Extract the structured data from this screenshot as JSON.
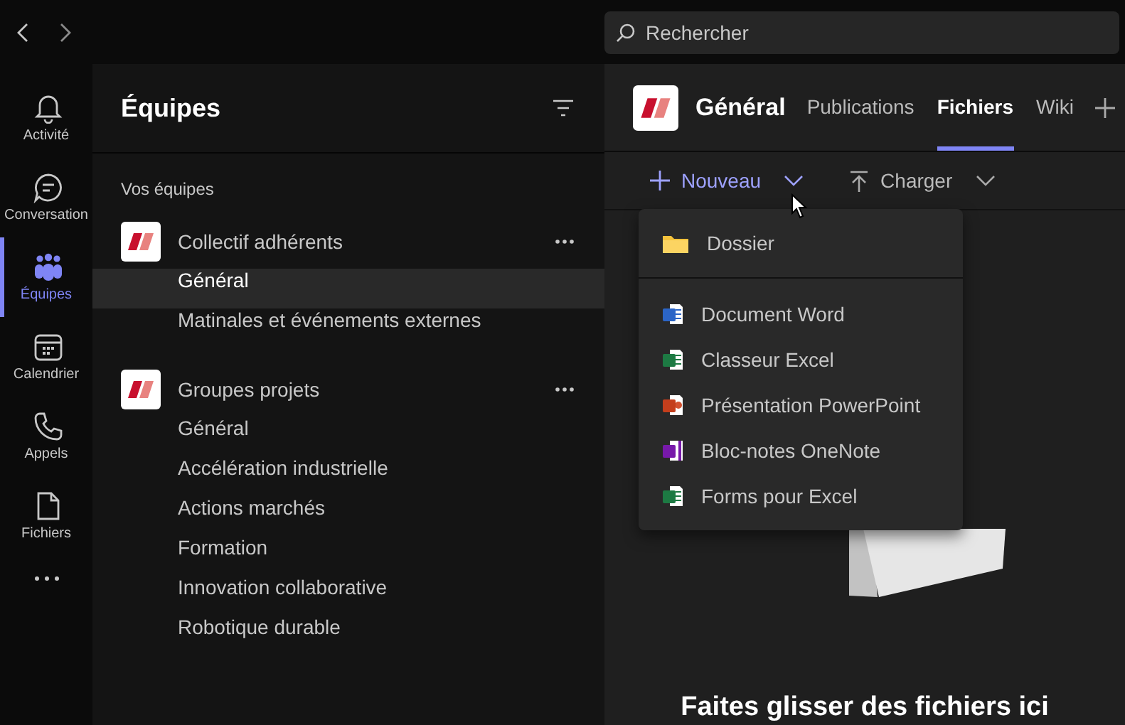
{
  "search": {
    "placeholder": "Rechercher"
  },
  "rail": [
    {
      "label": "Activité",
      "kind": "bell",
      "selected": false
    },
    {
      "label": "Conversation",
      "kind": "chat",
      "selected": false
    },
    {
      "label": "Équipes",
      "kind": "teams",
      "selected": true
    },
    {
      "label": "Calendrier",
      "kind": "calendar",
      "selected": false
    },
    {
      "label": "Appels",
      "kind": "phone",
      "selected": false
    },
    {
      "label": "Fichiers",
      "kind": "file",
      "selected": false
    }
  ],
  "teams_panel": {
    "title": "Équipes",
    "section": "Vos équipes",
    "teams": [
      {
        "name": "Collectif adhérents",
        "channels": [
          {
            "name": "Général",
            "selected": true
          },
          {
            "name": "Matinales et événements externes",
            "selected": false
          }
        ]
      },
      {
        "name": "Groupes projets",
        "channels": [
          {
            "name": "Général",
            "selected": false
          },
          {
            "name": "Accélération industrielle",
            "selected": false
          },
          {
            "name": "Actions marchés",
            "selected": false
          },
          {
            "name": "Formation",
            "selected": false
          },
          {
            "name": "Innovation collaborative",
            "selected": false
          },
          {
            "name": "Robotique durable",
            "selected": false
          }
        ]
      }
    ]
  },
  "channel": {
    "title": "Général",
    "tabs": [
      {
        "label": "Publications",
        "selected": false
      },
      {
        "label": "Fichiers",
        "selected": true
      },
      {
        "label": "Wiki",
        "selected": false
      }
    ]
  },
  "toolbar": [
    {
      "label": "Nouveau",
      "kind": "new",
      "expanded": true
    },
    {
      "label": "Charger",
      "kind": "upload",
      "expanded": false
    }
  ],
  "menu": {
    "items": [
      {
        "label": "Dossier",
        "kind": "folder"
      },
      {
        "label": "Document Word",
        "kind": "word"
      },
      {
        "label": "Classeur Excel",
        "kind": "excel"
      },
      {
        "label": "Présentation PowerPoint",
        "kind": "powerpoint"
      },
      {
        "label": "Bloc-notes OneNote",
        "kind": "onenote"
      },
      {
        "label": "Forms pour Excel",
        "kind": "excel"
      }
    ]
  },
  "empty_state": {
    "message": "Faites glisser des fichiers ici"
  }
}
